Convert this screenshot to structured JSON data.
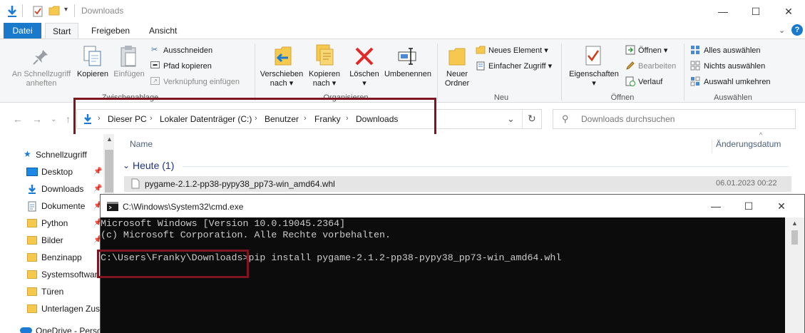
{
  "explorer": {
    "title": "Downloads",
    "window_controls": [
      "—",
      "☐",
      "✕"
    ],
    "tabs": {
      "file": "Datei",
      "start": "Start",
      "share": "Freigeben",
      "view": "Ansicht"
    },
    "ribbon": {
      "pin_quick_access": [
        "An Schnellzugriff",
        "anheften"
      ],
      "copy": "Kopieren",
      "paste": "Einfügen",
      "cut": "Ausschneiden",
      "copy_path": "Pfad kopieren",
      "paste_shortcut": "Verknüpfung einfügen",
      "group_clipboard": "Zwischenablage",
      "move_to": [
        "Verschieben",
        "nach"
      ],
      "copy_to": [
        "Kopieren",
        "nach"
      ],
      "delete": "Löschen",
      "rename": "Umbenennen",
      "group_organize": "Organisieren",
      "new_folder": [
        "Neuer",
        "Ordner"
      ],
      "new_item": "Neues Element",
      "easy_access": "Einfacher Zugriff",
      "group_new": "Neu",
      "properties": "Eigenschaften",
      "open": "Öffnen",
      "edit": "Bearbeiten",
      "history": "Verlauf",
      "group_open": "Öffnen",
      "select_all": "Alles auswählen",
      "select_none": "Nichts auswählen",
      "invert_selection": "Auswahl umkehren",
      "group_select": "Auswählen"
    },
    "breadcrumb": [
      "Dieser PC",
      "Lokaler Datenträger (C:)",
      "Benutzer",
      "Franky",
      "Downloads"
    ],
    "search_placeholder": "Downloads durchsuchen",
    "nav": {
      "quick_access": "Schnellzugriff",
      "items": [
        "Desktop",
        "Downloads",
        "Dokumente",
        "Python",
        "Bilder",
        "Benzinapp",
        "Systemsoftwar",
        "Türen",
        "Unterlagen Zus"
      ],
      "onedrive": "OneDrive - Perso"
    },
    "columns": {
      "name": "Name",
      "modified": "Änderungsdatum"
    },
    "group_header": "Heute (1)",
    "files": [
      {
        "name": "pygame-2.1.2-pp38-pypy38_pp73-win_amd64.whl",
        "date": "06.01.2023 00:22"
      }
    ]
  },
  "cmd": {
    "title": "C:\\Windows\\System32\\cmd.exe",
    "lines": [
      "Microsoft Windows [Version 10.0.19045.2364]",
      "(c) Microsoft Corporation. Alle Rechte vorbehalten.",
      "",
      "C:\\Users\\Franky\\Downloads>pip install pygame-2.1.2-pp38-pypy38_pp73-win_amd64.whl"
    ]
  },
  "colors": {
    "accent": "#1979ca",
    "highlight_frame": "#7e1520",
    "console_bg": "#0c0c0c",
    "console_text": "#cccccc"
  }
}
